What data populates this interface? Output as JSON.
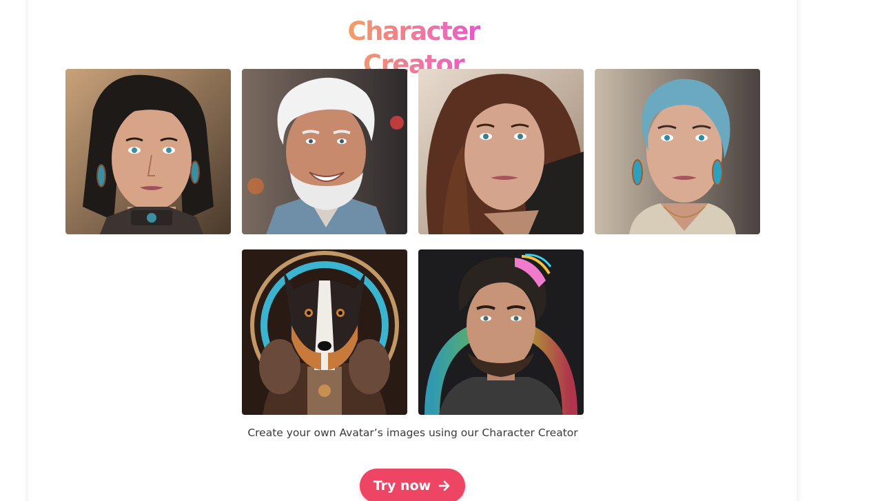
{
  "header": {
    "title": "Character Creator"
  },
  "gallery": {
    "items": [
      {
        "name": "avatar-woman-dark-bob",
        "subject": "woman with dark bob hair and earrings",
        "colors": {
          "bg": "#8a6a4a",
          "hair": "#1e1a18",
          "skin": "#d7a488",
          "accent": "#3b8fa0"
        }
      },
      {
        "name": "avatar-man-white-hair",
        "subject": "smiling man with white hair and beard",
        "colors": {
          "bg": "#5a4a48",
          "hair": "#f2f2f2",
          "skin": "#c88a6c",
          "accent": "#6f8ea8"
        }
      },
      {
        "name": "avatar-woman-brown-hair",
        "subject": "woman with long brown hair",
        "colors": {
          "bg": "#d8cabd",
          "hair": "#5a3020",
          "skin": "#d5a48c",
          "accent": "#2a2a2a"
        }
      },
      {
        "name": "avatar-woman-blue-hair",
        "subject": "woman with blue hair and earrings",
        "colors": {
          "bg": "#a89a88",
          "hair": "#6ba9c0",
          "skin": "#d9ab93",
          "accent": "#d8cdb8"
        }
      },
      {
        "name": "avatar-dog",
        "subject": "dog in ornate costume with halo",
        "colors": {
          "bg": "#2a1a14",
          "hair": "#5a3a2a",
          "skin": "#2a2220",
          "accent": "#3bb4d0"
        }
      },
      {
        "name": "avatar-man-rainbow-hair",
        "subject": "bearded man with rainbow-streaked hair",
        "colors": {
          "bg": "#1c1c1e",
          "hair": "#2a2420",
          "skin": "#c89478",
          "accent": "#f07acb"
        }
      }
    ]
  },
  "caption": "Create your own Avatar’s images using our Character Creator",
  "cta": {
    "label": "Try now",
    "icon": "arrow-right-icon",
    "color": "#ef4565"
  },
  "theme": {
    "title_gradient": [
      "#f8b84e",
      "#ec6cb6",
      "#d844e0"
    ]
  }
}
